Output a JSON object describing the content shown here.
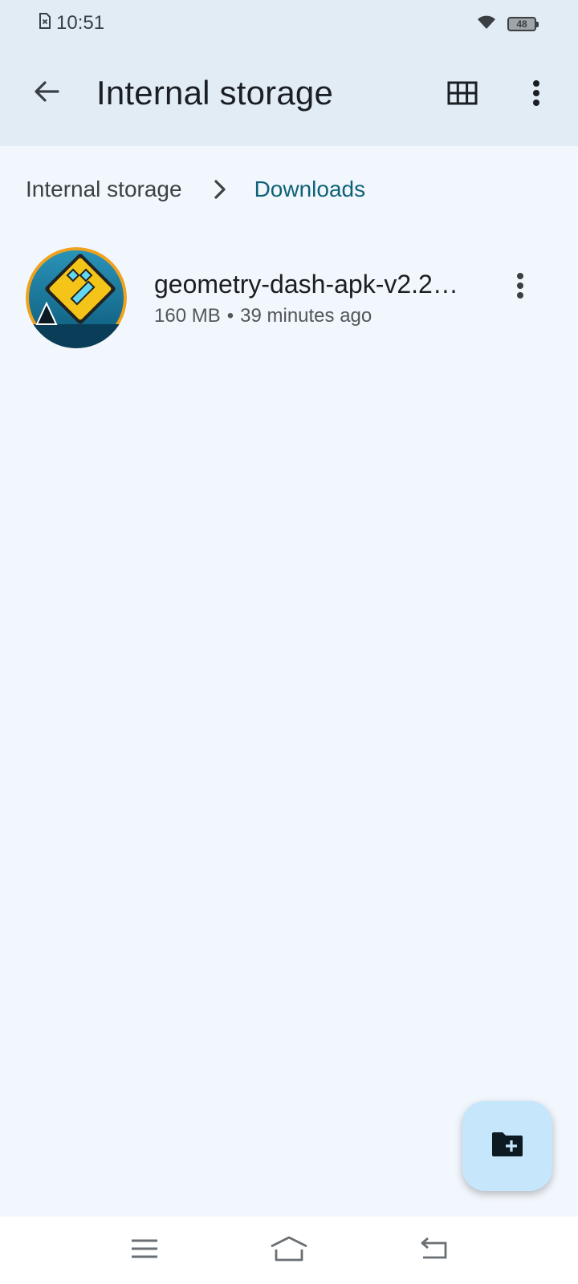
{
  "status_bar": {
    "time": "10:51",
    "battery_level": "48",
    "icons": [
      "sim-error-icon",
      "wifi-icon",
      "battery-icon"
    ]
  },
  "app_bar": {
    "title": "Internal storage",
    "icons": [
      "back-arrow-icon",
      "grid-view-icon",
      "more-vert-icon"
    ]
  },
  "breadcrumb": {
    "root": "Internal storage",
    "current": "Downloads"
  },
  "files": [
    {
      "name": "geometry-dash-apk-v2.2…",
      "size": "160 MB",
      "separator": "•",
      "modified": "39 minutes ago",
      "thumbnail_icon": "geometry-dash-app-icon"
    }
  ],
  "fab": {
    "icon": "new-folder-icon"
  },
  "nav_bar": {
    "icons": [
      "recents-menu-icon",
      "home-icon",
      "back-icon"
    ]
  },
  "colors": {
    "app_bar_bg": "#e1ecf4",
    "page_bg": "#f2f7fd",
    "breadcrumb_active": "#0f6178",
    "fab_bg": "#c5e6fb"
  }
}
